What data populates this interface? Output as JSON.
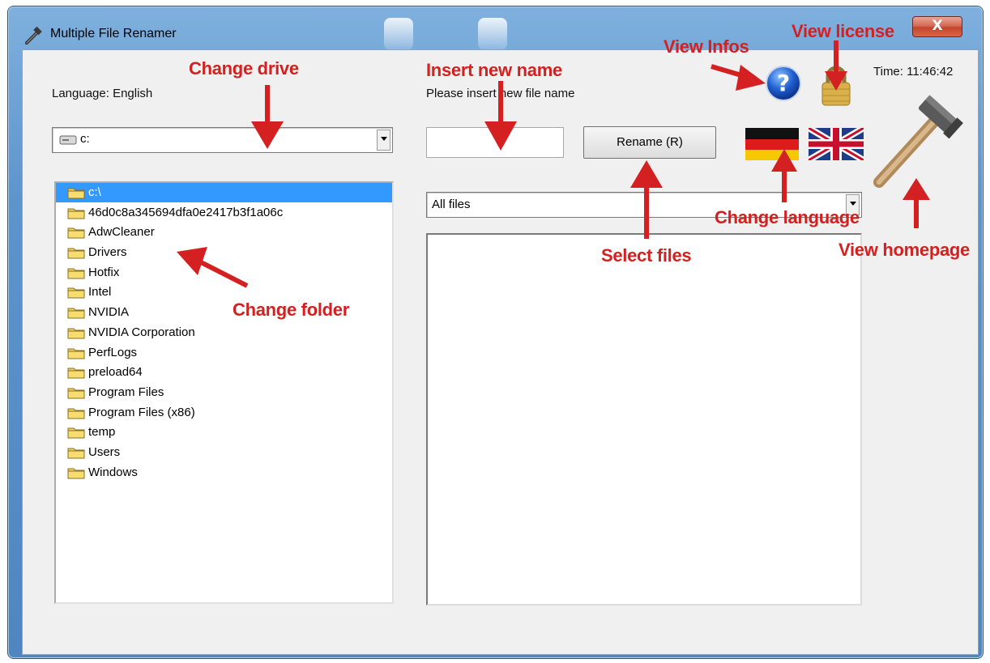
{
  "window": {
    "title": "Multiple File Renamer",
    "close_label": "X"
  },
  "top": {
    "language_label": "Language: English",
    "insert_hint": "Please insert new file name",
    "time_label": "Time: 11:46:42"
  },
  "drive": {
    "value": "c:"
  },
  "rename": {
    "name_value": "",
    "button_label": "Rename (R)"
  },
  "filter": {
    "value": "All files"
  },
  "tree": {
    "items": [
      {
        "label": "c:\\",
        "selected": true,
        "open": true
      },
      {
        "label": "46d0c8a345694dfa0e2417b3f1a06c"
      },
      {
        "label": "AdwCleaner"
      },
      {
        "label": "Drivers"
      },
      {
        "label": "Hotfix"
      },
      {
        "label": "Intel"
      },
      {
        "label": "NVIDIA"
      },
      {
        "label": "NVIDIA Corporation"
      },
      {
        "label": "PerfLogs"
      },
      {
        "label": "preload64"
      },
      {
        "label": "Program Files"
      },
      {
        "label": "Program Files (x86)"
      },
      {
        "label": "temp"
      },
      {
        "label": "Users"
      },
      {
        "label": "Windows"
      }
    ]
  },
  "annotations": {
    "change_drive": "Change drive",
    "insert_new_name": "Insert new name",
    "view_infos": "View Infos",
    "view_license": "View license",
    "change_folder": "Change folder",
    "select_files": "Select files",
    "change_language": "Change language",
    "view_homepage": "View homepage"
  },
  "colors": {
    "annotation": "#d42020",
    "selection": "#3399ff",
    "titlebar": "#5d94cc"
  },
  "icons": {
    "app": "hammer-pencil-icon",
    "help": "question-mark-icon",
    "license": "padlock-icon",
    "german_flag": "germany-flag-icon",
    "uk_flag": "uk-flag-icon",
    "homepage": "hammer-icon"
  }
}
